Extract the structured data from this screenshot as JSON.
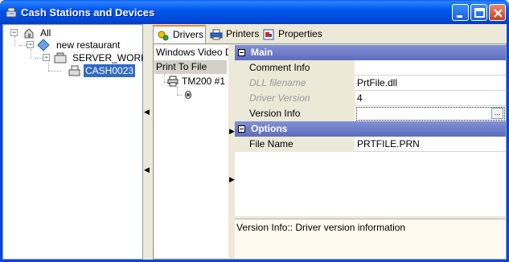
{
  "window": {
    "title": "Cash Stations and Devices"
  },
  "tree": {
    "nodes": [
      {
        "label": "All"
      },
      {
        "label": "new restaurant"
      },
      {
        "label": "SERVER_WORK"
      },
      {
        "label": "CASH0023"
      }
    ]
  },
  "tabs": [
    {
      "label": "Drivers"
    },
    {
      "label": "Printers"
    },
    {
      "label": "Properties"
    }
  ],
  "devices": {
    "header": "Windows Video Dr",
    "selected": "Print To File",
    "child": "TM200 #1"
  },
  "grid": {
    "categories": [
      "Main",
      "Options"
    ],
    "rows": [
      {
        "name": "Comment Info",
        "value": ""
      },
      {
        "name": "DLL filename",
        "value": "PrtFile.dll"
      },
      {
        "name": "Driver Version",
        "value": "4"
      },
      {
        "name": "Version Info",
        "value": ""
      },
      {
        "name": "File Name",
        "value": "PRTFILE.PRN"
      }
    ],
    "ellipsis": "...",
    "description": "Version Info:: Driver version information"
  },
  "colors": {
    "titlebar": "#0058ee",
    "selection": "#316ac5",
    "category": "#6b7ac8"
  }
}
